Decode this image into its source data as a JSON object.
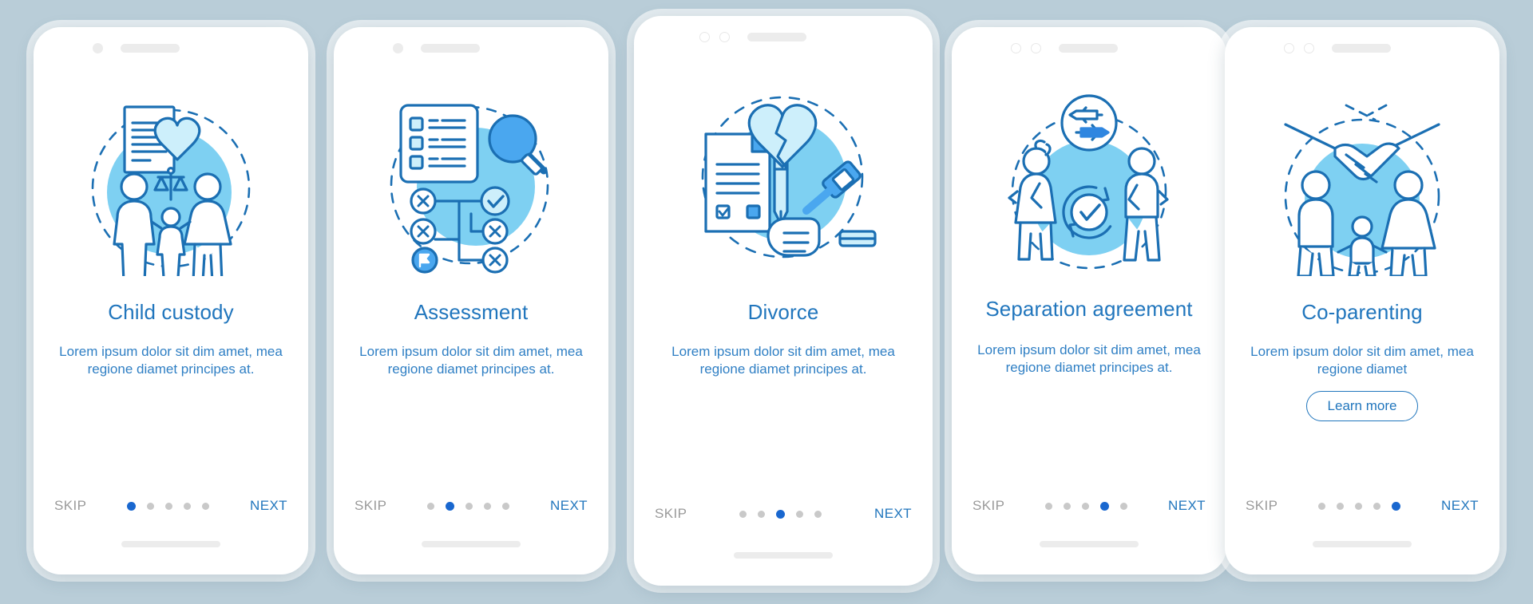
{
  "theme": {
    "background": "#b9cdd8",
    "card_background": "#ffffff",
    "title_color": "#2176bd",
    "body_color": "#2f7fc4",
    "accent_blue": "#1967cf",
    "line_blue": "#1b6fb3",
    "fill_light_blue": "#7ed0f2",
    "fill_pale_blue": "#cdeffb",
    "muted_gray": "#9a9a9a",
    "dot_inactive": "#c9c9c9"
  },
  "screens": [
    {
      "id": "child-custody",
      "title": "Child custody",
      "description": "Lorem ipsum dolor sit dim amet, mea regione diamet principes at.",
      "illustration": "family-document-scales-heart-icon",
      "skip_label": "SKIP",
      "next_label": "NEXT",
      "dots": 5,
      "active_dot": 1,
      "status_icons": [
        "circle-filled-icon",
        "pill-bar-icon"
      ],
      "has_learn_more": false,
      "learn_more_label": ""
    },
    {
      "id": "assessment",
      "title": "Assessment",
      "description": "Lorem ipsum dolor sit dim amet, mea regione diamet principes at.",
      "illustration": "checklist-magnifier-flowchart-icon",
      "skip_label": "SKIP",
      "next_label": "NEXT",
      "dots": 5,
      "active_dot": 2,
      "status_icons": [
        "circle-filled-icon",
        "pill-bar-icon"
      ],
      "has_learn_more": false,
      "learn_more_label": ""
    },
    {
      "id": "divorce",
      "title": "Divorce",
      "description": "Lorem ipsum dolor sit dim amet, mea regione diamet principes at.",
      "illustration": "document-pen-broken-heart-gavel-icon",
      "skip_label": "SKIP",
      "next_label": "NEXT",
      "dots": 5,
      "active_dot": 3,
      "status_icons": [
        "circle-ring-icon",
        "circle-ring-icon",
        "pill-bar-icon"
      ],
      "has_learn_more": false,
      "learn_more_label": ""
    },
    {
      "id": "separation-agreement",
      "title": "Separation agreement",
      "description": "Lorem ipsum dolor sit dim amet, mea regione diamet principes at.",
      "illustration": "couple-apart-exchange-arrows-refresh-check-icon",
      "skip_label": "SKIP",
      "next_label": "NEXT",
      "dots": 5,
      "active_dot": 4,
      "status_icons": [
        "circle-ring-icon",
        "circle-ring-icon",
        "pill-bar-icon"
      ],
      "has_learn_more": false,
      "learn_more_label": ""
    },
    {
      "id": "co-parenting",
      "title": "Co-parenting",
      "description": "Lorem ipsum dolor sit dim amet, mea regione diamet",
      "illustration": "handshake-family-icon",
      "skip_label": "SKIP",
      "next_label": "NEXT",
      "dots": 5,
      "active_dot": 5,
      "status_icons": [
        "circle-ring-icon",
        "circle-ring-icon",
        "pill-bar-icon"
      ],
      "has_learn_more": true,
      "learn_more_label": "Learn more"
    }
  ]
}
